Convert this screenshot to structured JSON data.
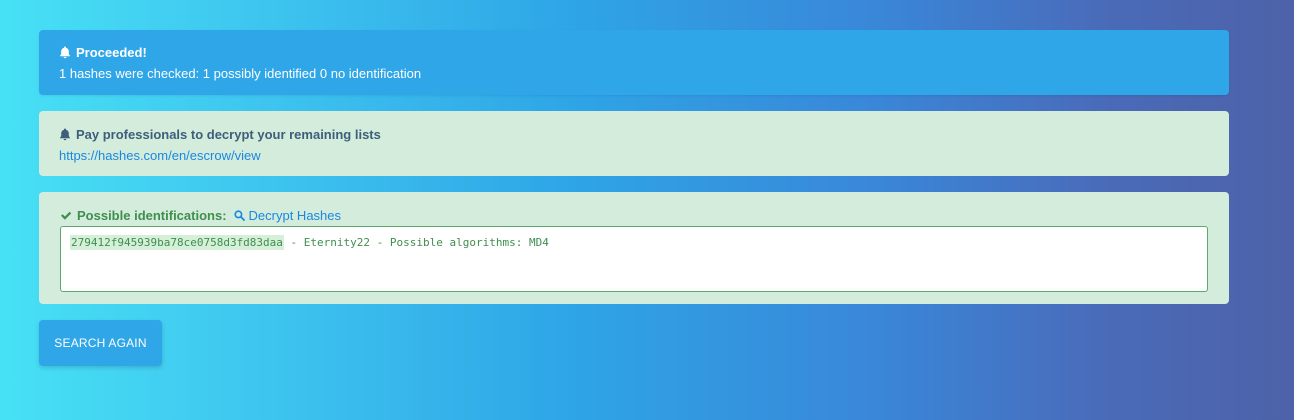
{
  "alert_info": {
    "title": "Proceeded!",
    "message": "1 hashes were checked: 1 possibly identified 0 no identification"
  },
  "alert_escrow": {
    "title": "Pay professionals to decrypt your remaining lists",
    "link": "https://hashes.com/en/escrow/view"
  },
  "alert_result": {
    "title": "Possible identifications:",
    "decrypt_link": "Decrypt Hashes",
    "hash": "279412f945939ba78ce0758d3fd83daa",
    "result_rest": " - Eternity22 - Possible algorithms: MD4"
  },
  "search_again_button": "SEARCH AGAIN",
  "colors": {
    "info": "#2ea6e8",
    "success_bg": "#d3ecdc",
    "success_text": "#3f8f4e",
    "link": "#1b87e0"
  }
}
